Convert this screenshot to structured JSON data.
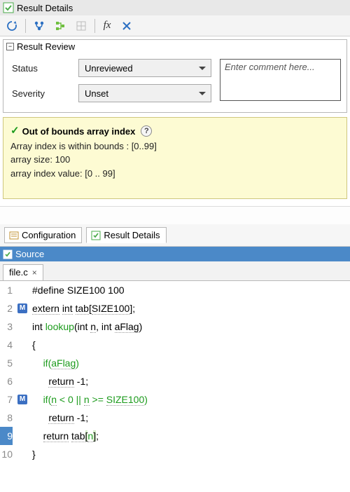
{
  "titleBar": {
    "title": "Result Details"
  },
  "toolbar": {
    "icons": [
      "reload-icon",
      "branch-icon",
      "tree-icon",
      "grid-icon"
    ],
    "fxLabel": "fx"
  },
  "review": {
    "header": "Result Review",
    "statusLabel": "Status",
    "statusValue": "Unreviewed",
    "severityLabel": "Severity",
    "severityValue": "Unset",
    "commentPlaceholder": "Enter comment here..."
  },
  "check": {
    "title": "Out of bounds array index",
    "line1": "Array index is within bounds : [0..99]",
    "line2": "array size: 100",
    "line3": "array index value: [0 .. 99]"
  },
  "tabs": {
    "config": "Configuration",
    "details": "Result Details",
    "source": "Source"
  },
  "file": {
    "name": "file.c"
  },
  "code": {
    "lines": [
      {
        "n": 1,
        "mark": "",
        "textParts": [
          [
            "p",
            "#define SIZE100 100"
          ]
        ]
      },
      {
        "n": 2,
        "mark": "M",
        "textParts": [
          [
            "t",
            "extern"
          ],
          [
            "s",
            " "
          ],
          [
            "t",
            "int"
          ],
          [
            "s",
            " "
          ],
          [
            "t",
            "tab"
          ],
          [
            "s",
            "["
          ],
          [
            "t",
            "SIZE100"
          ],
          [
            "s",
            "];"
          ]
        ]
      },
      {
        "n": 3,
        "mark": "",
        "textParts": [
          [
            "p",
            "int "
          ],
          [
            "g",
            "lookup"
          ],
          [
            "p",
            "(int "
          ],
          [
            "t",
            "n"
          ],
          [
            "p",
            ", int "
          ],
          [
            "t",
            "aFlag"
          ],
          [
            "p",
            ")"
          ]
        ]
      },
      {
        "n": 4,
        "mark": "",
        "textParts": [
          [
            "p",
            "{"
          ]
        ]
      },
      {
        "n": 5,
        "mark": "",
        "textParts": [
          [
            "p",
            "    "
          ],
          [
            "g",
            "if"
          ],
          [
            "g",
            "("
          ],
          [
            "gt",
            "aFlag"
          ],
          [
            "g",
            ")"
          ]
        ]
      },
      {
        "n": 6,
        "mark": "",
        "textParts": [
          [
            "p",
            "      "
          ],
          [
            "t",
            "return"
          ],
          [
            "p",
            " -1;"
          ]
        ]
      },
      {
        "n": 7,
        "mark": "M",
        "textParts": [
          [
            "p",
            "    "
          ],
          [
            "g",
            "if"
          ],
          [
            "g",
            "("
          ],
          [
            "gt",
            "n"
          ],
          [
            "g",
            " < 0 || "
          ],
          [
            "gt",
            "n"
          ],
          [
            "g",
            " >= "
          ],
          [
            "gt",
            "SIZE100"
          ],
          [
            "g",
            ")"
          ]
        ]
      },
      {
        "n": 8,
        "mark": "",
        "textParts": [
          [
            "p",
            "      "
          ],
          [
            "t",
            "return"
          ],
          [
            "p",
            " -1;"
          ]
        ]
      },
      {
        "n": 9,
        "mark": "",
        "selected": true,
        "textParts": [
          [
            "p",
            "    "
          ],
          [
            "t",
            "return"
          ],
          [
            "p",
            " "
          ],
          [
            "t",
            "tab"
          ],
          [
            "idx",
            "["
          ],
          [
            "gt",
            "n"
          ],
          [
            "idx",
            "]"
          ],
          [
            "p",
            ";"
          ]
        ]
      },
      {
        "n": 10,
        "mark": "",
        "textParts": [
          [
            "p",
            "}"
          ]
        ]
      }
    ]
  }
}
